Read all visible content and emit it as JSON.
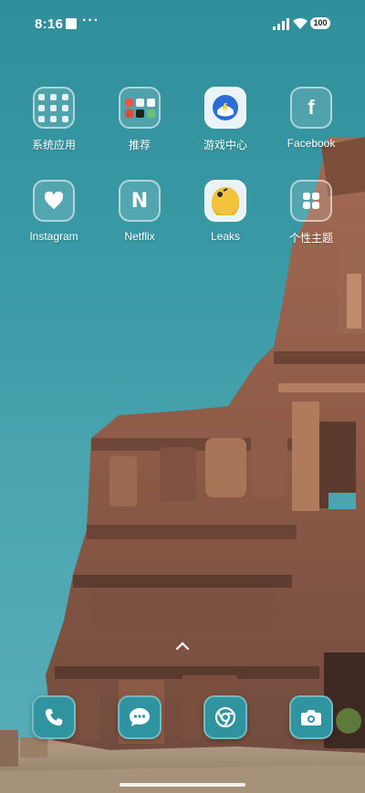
{
  "status_bar": {
    "time": "8:16",
    "more_indicator": "···",
    "battery": "100"
  },
  "apps": [
    {
      "label": "系统应用",
      "icon": "folder-grid-icon"
    },
    {
      "label": "推荐",
      "icon": "app-folder-icon"
    },
    {
      "label": "游戏中心",
      "icon": "game-center-icon"
    },
    {
      "label": "Facebook",
      "icon": "facebook-icon"
    },
    {
      "label": "Instagram",
      "icon": "heart-icon"
    },
    {
      "label": "Netflix",
      "icon": "netflix-n-icon"
    },
    {
      "label": "Leaks",
      "icon": "leaks-icon"
    },
    {
      "label": "个性主题",
      "icon": "theme-grid-icon"
    }
  ],
  "dock": [
    {
      "name": "phone",
      "icon": "phone-icon"
    },
    {
      "name": "messages",
      "icon": "message-icon"
    },
    {
      "name": "browser",
      "icon": "chrome-icon"
    },
    {
      "name": "camera",
      "icon": "camera-icon"
    }
  ],
  "colors": {
    "sky": "#3a9aa6",
    "icon_fill": "#2f93a0",
    "stone": "#8a5a45"
  }
}
